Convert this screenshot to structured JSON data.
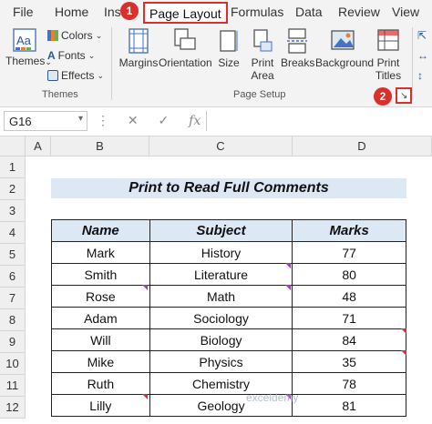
{
  "tabs": {
    "file": "File",
    "home": "Home",
    "insert": "Ins",
    "page_layout": "Page Layout",
    "formulas": "Formulas",
    "data": "Data",
    "review": "Review",
    "view": "View"
  },
  "badges": {
    "one": "1",
    "two": "2"
  },
  "ribbon": {
    "themes_group": {
      "themes": "Themes",
      "colors": "Colors",
      "fonts": "Fonts",
      "effects": "Effects",
      "label": "Themes"
    },
    "page_setup_group": {
      "margins": "Margins",
      "orientation": "Orientation",
      "size": "Size",
      "print_area_1": "Print",
      "print_area_2": "Area",
      "breaks": "Breaks",
      "background": "Background",
      "print_titles_1": "Print",
      "print_titles_2": "Titles",
      "label": "Page Setup"
    },
    "launcher_icon": "dialog-launcher-icon"
  },
  "formula_bar": {
    "name_box": "G16",
    "fx": "fx",
    "value": ""
  },
  "columns": [
    "A",
    "B",
    "C",
    "D"
  ],
  "rows": [
    "1",
    "2",
    "3",
    "4",
    "5",
    "6",
    "7",
    "8",
    "9",
    "10",
    "11",
    "12"
  ],
  "sheet": {
    "title": "Print to Read Full Comments",
    "headers": [
      "Name",
      "Subject",
      "Marks"
    ],
    "records": [
      [
        "Mark",
        "History",
        "77"
      ],
      [
        "Smith",
        "Literature",
        "80"
      ],
      [
        "Rose",
        "Math",
        "48"
      ],
      [
        "Adam",
        "Sociology",
        "71"
      ],
      [
        "Will",
        "Biology",
        "84"
      ],
      [
        "Mike",
        "Physics",
        "35"
      ],
      [
        "Ruth",
        "Chemistry",
        "78"
      ],
      [
        "Lilly",
        "Geology",
        "81"
      ]
    ]
  },
  "watermark": "exceldemy",
  "colors": {
    "accent_red": "#d9302c",
    "header_fill": "#dde8f5",
    "comment_purple": "#a23ab8"
  }
}
